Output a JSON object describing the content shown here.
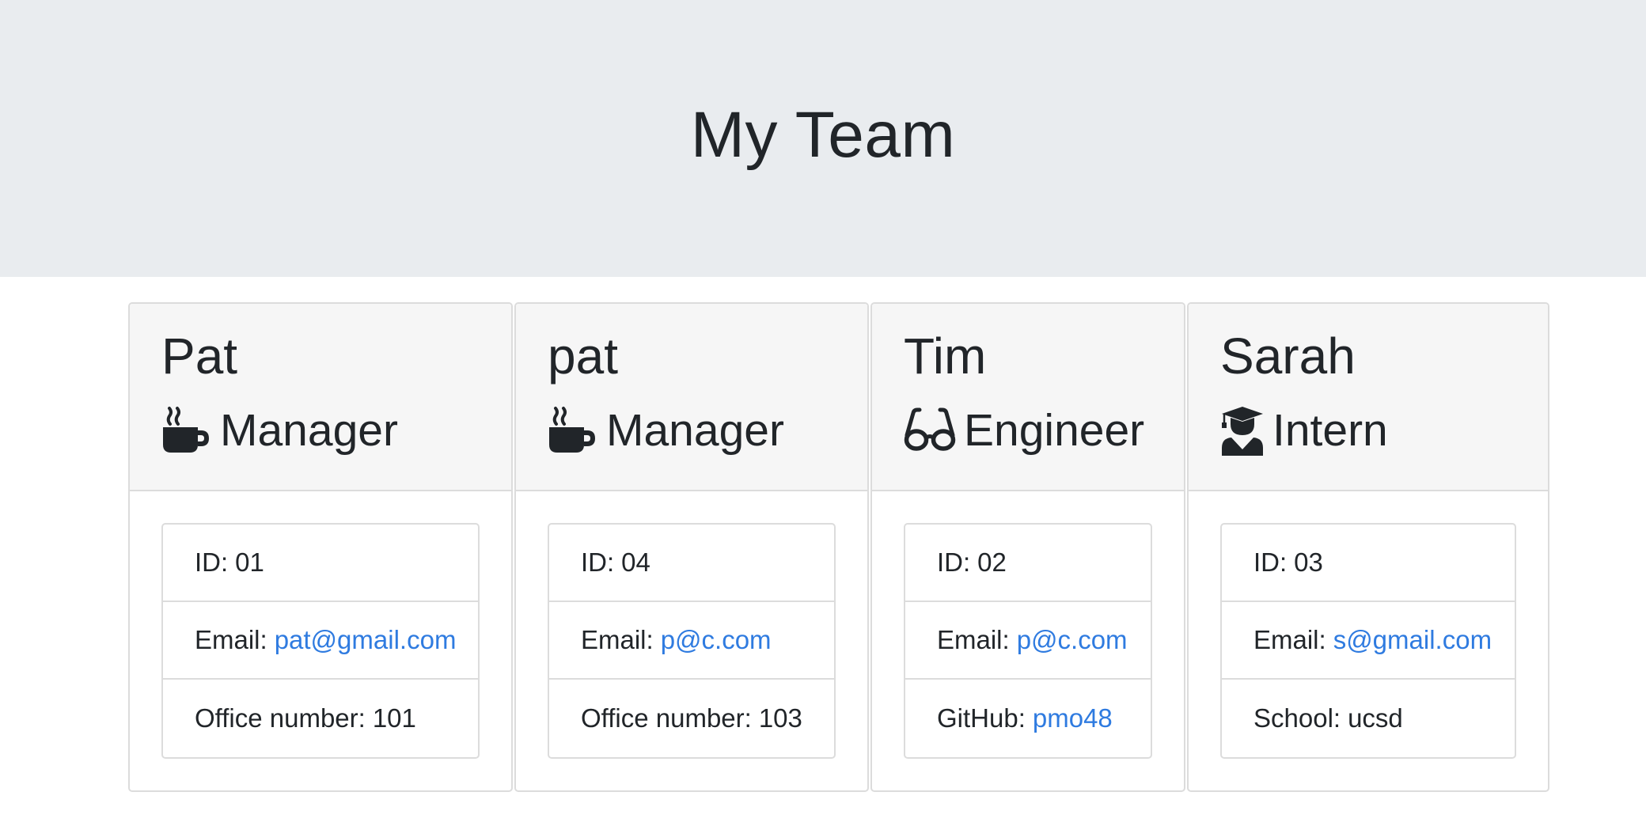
{
  "header": {
    "title": "My Team"
  },
  "employees": [
    {
      "name": "Pat",
      "role": "Manager",
      "icon": "mug-hot-icon",
      "id_label": "ID:",
      "id": "01",
      "email_label": "Email:",
      "email": "pat@gmail.com",
      "extra_label": "Office number:",
      "extra": "101"
    },
    {
      "name": "pat",
      "role": "Manager",
      "icon": "mug-hot-icon",
      "id_label": "ID:",
      "id": "04",
      "email_label": "Email:",
      "email": "p@c.com",
      "extra_label": "Office number:",
      "extra": "103"
    },
    {
      "name": "Tim",
      "role": "Engineer",
      "icon": "glasses-icon",
      "id_label": "ID:",
      "id": "02",
      "email_label": "Email:",
      "email": "p@c.com",
      "extra_label": "GitHub:",
      "extra": "pmo48"
    },
    {
      "name": "Sarah",
      "role": "Intern",
      "icon": "graduate-icon",
      "id_label": "ID:",
      "id": "03",
      "email_label": "Email:",
      "email": "s@gmail.com",
      "extra_label": "School:",
      "extra": "ucsd"
    }
  ],
  "colors": {
    "header_bg": "#e9ecef",
    "card_header_bg": "#f6f6f6",
    "link": "#2f7be0",
    "text": "#212529"
  }
}
